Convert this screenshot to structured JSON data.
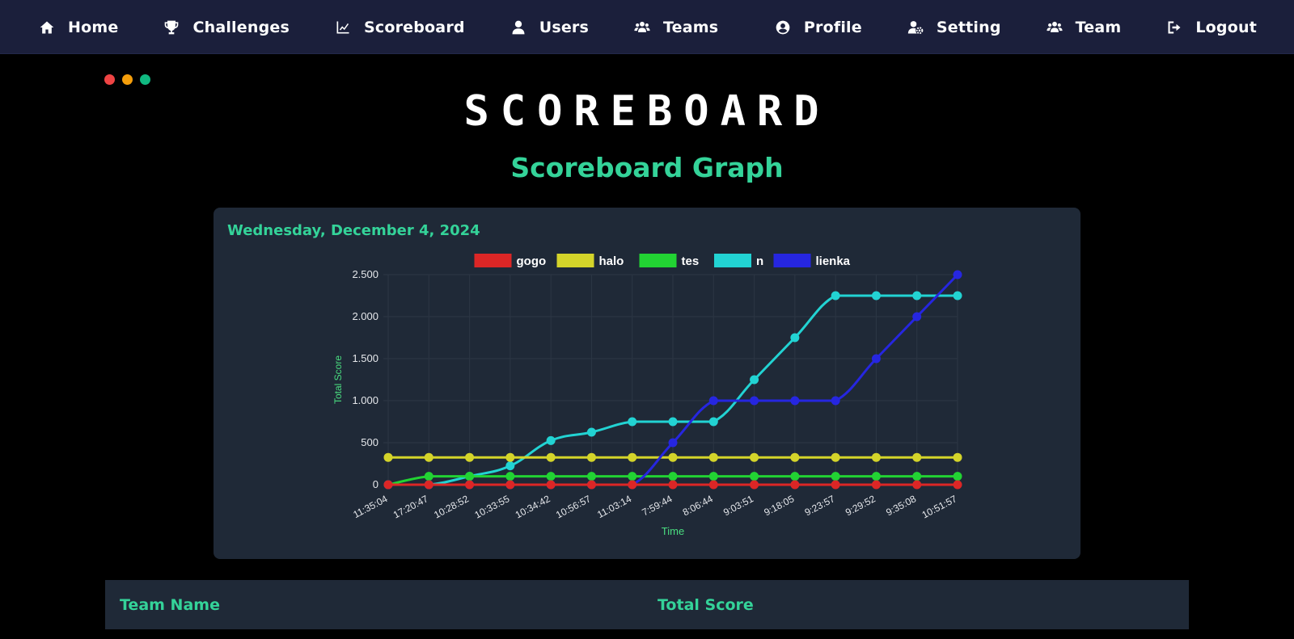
{
  "nav": {
    "left": [
      {
        "label": "Home",
        "icon": "home-icon"
      },
      {
        "label": "Challenges",
        "icon": "trophy-icon"
      },
      {
        "label": "Scoreboard",
        "icon": "chart-line-icon"
      },
      {
        "label": "Users",
        "icon": "user-icon"
      },
      {
        "label": "Teams",
        "icon": "users-icon"
      }
    ],
    "right": [
      {
        "label": "Profile",
        "icon": "user-circle-icon"
      },
      {
        "label": "Setting",
        "icon": "user-gear-icon"
      },
      {
        "label": "Team",
        "icon": "users-icon"
      },
      {
        "label": "Logout",
        "icon": "logout-icon"
      }
    ]
  },
  "window_dots": [
    "#ef4444",
    "#f59e0b",
    "#10b981"
  ],
  "page_title": "SCOREBOARD",
  "sub_title": "Scoreboard Graph",
  "graph_date": "Wednesday, December 4, 2024",
  "colors": {
    "accent": "#34d399",
    "nav_bg": "#1b1f3b",
    "card_bg": "#1f2937"
  },
  "chart_data": {
    "type": "line",
    "xlabel": "Time",
    "ylabel": "Total Score",
    "ylim": [
      0,
      2500
    ],
    "y_ticks": [
      "0",
      "500",
      "1.000",
      "1.500",
      "2.000",
      "2.500"
    ],
    "y_tick_values": [
      0,
      500,
      1000,
      1500,
      2000,
      2500
    ],
    "categories": [
      "11:35:04",
      "17:20:47",
      "10:28:52",
      "10:33:55",
      "10:34:42",
      "10:56:57",
      "11:03:14",
      "7:59:44",
      "8:06:44",
      "9:03:51",
      "9:18:05",
      "9:23:57",
      "9:29:52",
      "9:35:08",
      "10:51:57"
    ],
    "legend_position": "top",
    "grid": true,
    "series": [
      {
        "name": "gogo",
        "color": "#dc2626",
        "values": [
          0,
          0,
          0,
          0,
          0,
          0,
          0,
          0,
          0,
          0,
          0,
          0,
          0,
          0,
          0
        ]
      },
      {
        "name": "halo",
        "color": "#d4d42a",
        "values": [
          325,
          325,
          325,
          325,
          325,
          325,
          325,
          325,
          325,
          325,
          325,
          325,
          325,
          325,
          325
        ]
      },
      {
        "name": "tes",
        "color": "#22d333",
        "values": [
          0,
          100,
          100,
          100,
          100,
          100,
          100,
          100,
          100,
          100,
          100,
          100,
          100,
          100,
          100
        ]
      },
      {
        "name": "n",
        "color": "#22d3d3",
        "values": [
          0,
          0,
          100,
          225,
          525,
          625,
          750,
          750,
          750,
          1250,
          1750,
          2250,
          2250,
          2250,
          2250
        ]
      },
      {
        "name": "lienka",
        "color": "#2626e0",
        "values": [
          0,
          0,
          0,
          0,
          0,
          0,
          0,
          500,
          1000,
          1000,
          1000,
          1000,
          1500,
          2000,
          2500
        ]
      }
    ]
  },
  "table": {
    "headers": [
      "Team Name",
      "Total Score"
    ]
  }
}
